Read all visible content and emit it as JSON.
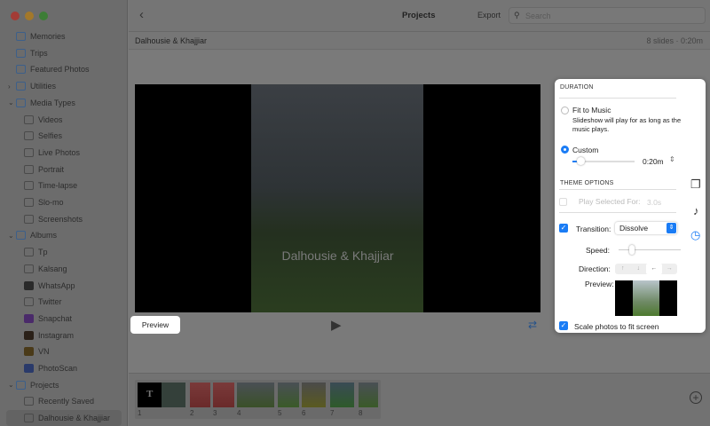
{
  "window": {
    "title": "Projects",
    "export_label": "Export",
    "search_placeholder": "Search",
    "back_icon": "chevron-left-icon"
  },
  "project": {
    "name": "Dalhousie & Khajjiar",
    "summary": "8 slides · 0:20m"
  },
  "sidebar": {
    "items": [
      {
        "label": "Memories",
        "level": 0,
        "icon": "memories-icon"
      },
      {
        "label": "Trips",
        "level": 0,
        "icon": "trips-icon"
      },
      {
        "label": "Featured Photos",
        "level": 0,
        "icon": "featured-photos-icon"
      },
      {
        "label": "Utilities",
        "level": 0,
        "icon": "utilities-icon",
        "disclosure": "collapsed"
      },
      {
        "label": "Media Types",
        "level": 0,
        "icon": "folder-icon",
        "disclosure": "expanded"
      },
      {
        "label": "Videos",
        "level": 1,
        "icon": "video-icon"
      },
      {
        "label": "Selfies",
        "level": 1,
        "icon": "selfie-icon"
      },
      {
        "label": "Live Photos",
        "level": 1,
        "icon": "live-photo-icon"
      },
      {
        "label": "Portrait",
        "level": 1,
        "icon": "portrait-icon"
      },
      {
        "label": "Time-lapse",
        "level": 1,
        "icon": "time-lapse-icon"
      },
      {
        "label": "Slo-mo",
        "level": 1,
        "icon": "slo-mo-icon"
      },
      {
        "label": "Screenshots",
        "level": 1,
        "icon": "screenshot-icon"
      },
      {
        "label": "Albums",
        "level": 0,
        "icon": "folder-icon",
        "disclosure": "expanded"
      },
      {
        "label": "Tp",
        "level": 1,
        "icon": "album-icon"
      },
      {
        "label": "Kalsang",
        "level": 1,
        "icon": "album-icon"
      },
      {
        "label": "WhatsApp",
        "level": 1,
        "icon": "album-thumbnail"
      },
      {
        "label": "Twitter",
        "level": 1,
        "icon": "album-icon"
      },
      {
        "label": "Snapchat",
        "level": 1,
        "icon": "album-thumbnail"
      },
      {
        "label": "Instagram",
        "level": 1,
        "icon": "album-thumbnail"
      },
      {
        "label": "VN",
        "level": 1,
        "icon": "album-thumbnail"
      },
      {
        "label": "PhotoScan",
        "level": 1,
        "icon": "album-thumbnail"
      },
      {
        "label": "Projects",
        "level": 0,
        "icon": "folder-icon",
        "disclosure": "expanded"
      },
      {
        "label": "Recently Saved",
        "level": 1,
        "icon": "slideshow-icon"
      },
      {
        "label": "Dalhousie & Khajjiar",
        "level": 1,
        "icon": "slideshow-icon",
        "selected": true
      }
    ]
  },
  "viewer": {
    "title_overlay": "Dalhousie & Khajjiar",
    "preview_label": "Preview",
    "play_icon": "play-icon",
    "repeat_icon": "repeat-icon"
  },
  "slides": [
    "1",
    "2",
    "3",
    "4",
    "5",
    "6",
    "7",
    "8"
  ],
  "title_slide_text": "T",
  "popover": {
    "duration_header": "DURATION",
    "fit_to_music": "Fit to Music",
    "fit_desc": "Slideshow will play for as long as the music plays.",
    "custom": "Custom",
    "duration_value": "0:20m",
    "duration_mode": "custom",
    "theme_header": "THEME OPTIONS",
    "play_selected": "Play Selected For:",
    "play_selected_value": "3.0s",
    "transition_label": "Transition:",
    "transition_value": "Dissolve",
    "speed_label": "Speed:",
    "direction_label": "Direction:",
    "directions": [
      "↑",
      "↓",
      "←",
      "→"
    ],
    "preview_label": "Preview:",
    "scale_label": "Scale photos to fit screen",
    "transition_checked": true,
    "scale_checked": true
  },
  "side_icons": [
    "themes-icon",
    "music-icon",
    "duration-icon"
  ],
  "colors": {
    "accent": "#1a7cf5"
  }
}
